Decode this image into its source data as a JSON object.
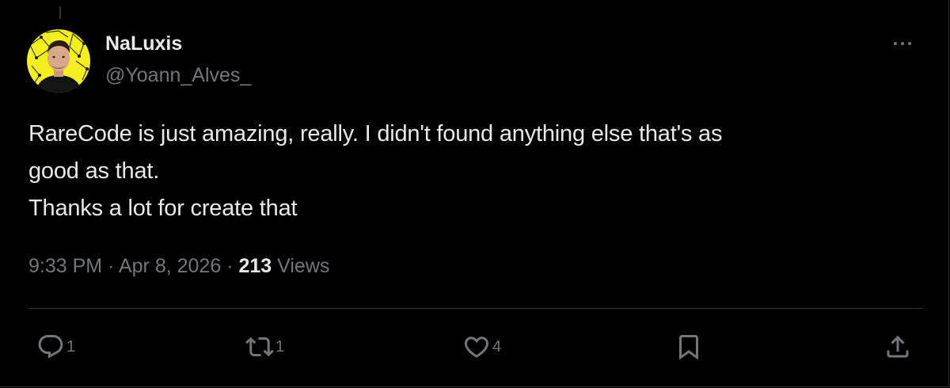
{
  "tweet": {
    "author": {
      "display_name": "NaLuxis",
      "handle": "@Yoann_Alves_"
    },
    "text_lines": [
      "RareCode is just amazing, really. I didn't found anything else that's as",
      "good as that.",
      "Thanks a lot for create that"
    ],
    "meta": {
      "time": "9:33 PM",
      "separator": "·",
      "date": "Apr 8, 2026",
      "views_count": "213",
      "views_label": "Views"
    },
    "actions": {
      "reply": {
        "icon": "reply-icon",
        "count": "1"
      },
      "repost": {
        "icon": "repost-icon",
        "count": "1"
      },
      "like": {
        "icon": "heart-icon",
        "count": "4"
      },
      "bookmark": {
        "icon": "bookmark-icon"
      },
      "share": {
        "icon": "share-icon"
      }
    }
  },
  "colors": {
    "background": "#000000",
    "text_primary": "#e7e9ea",
    "text_secondary": "#71767b",
    "divider": "#2f3336",
    "avatar_background": "#f2ee1f"
  }
}
